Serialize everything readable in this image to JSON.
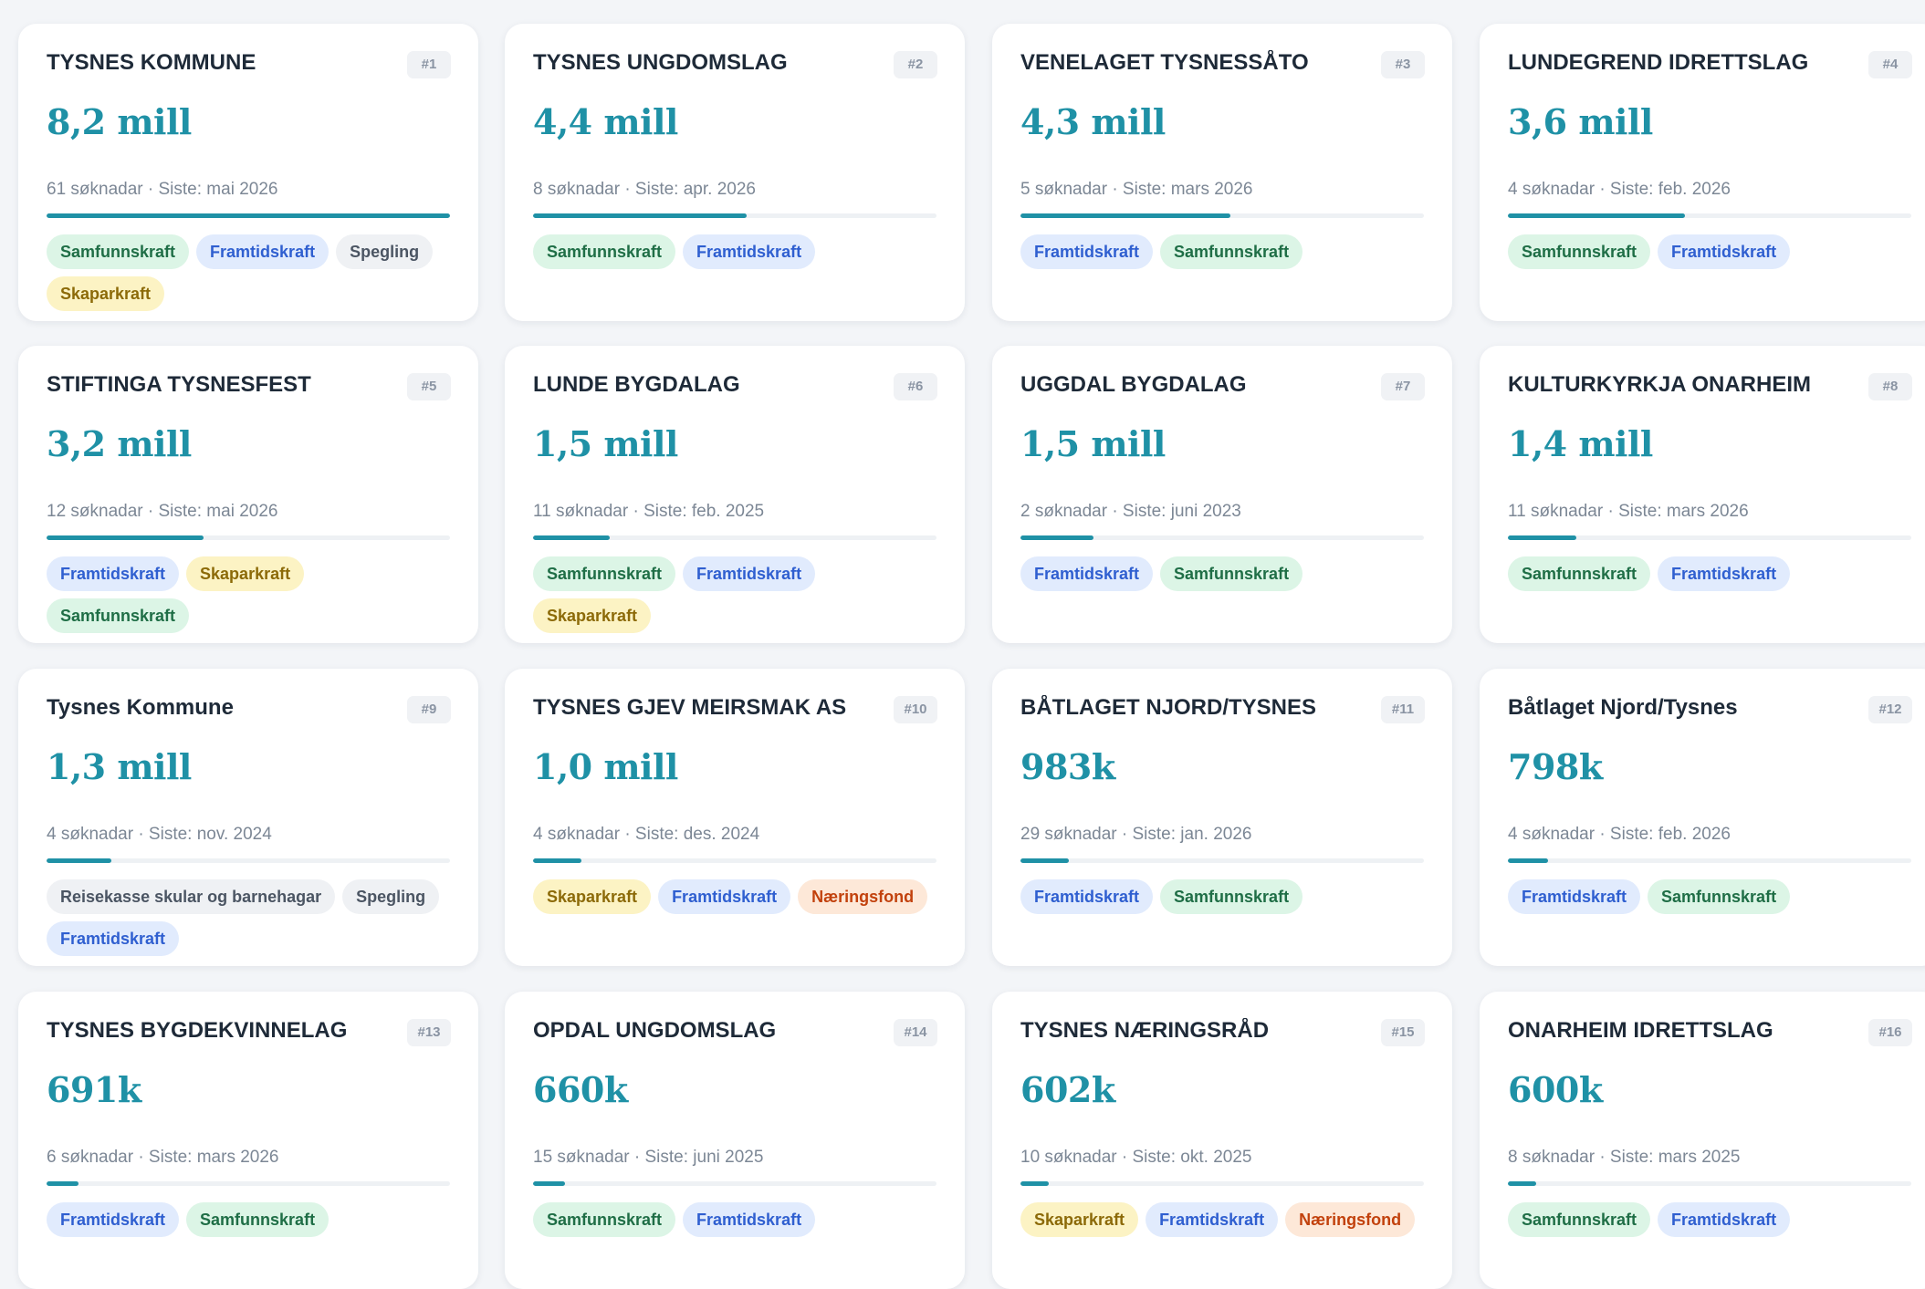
{
  "tag_styles": {
    "Samfunnskraft": {
      "bg": "#dcf5e6",
      "fg": "#1f6e46"
    },
    "Framtidskraft": {
      "bg": "#e1ebfd",
      "fg": "#2f5fd0"
    },
    "Skaparkraft": {
      "bg": "#fcf3c4",
      "fg": "#8c6a08"
    },
    "Spegling": {
      "bg": "#eff1f4",
      "fg": "#4b5563"
    },
    "Reisekasse skular og barnehagar": {
      "bg": "#eff1f4",
      "fg": "#4b5563"
    },
    "Næringsfond": {
      "bg": "#fde8d8",
      "fg": "#c2410c"
    }
  },
  "cards": [
    {
      "name": "TYSNES KOMMUNE",
      "rank": "#1",
      "amount": "8,2 mill",
      "meta": "61 søknadar · Siste: mai 2026",
      "progress": 1.0,
      "tags": [
        "Samfunnskraft",
        "Framtidskraft",
        "Spegling",
        "Skaparkraft"
      ]
    },
    {
      "name": "TYSNES UNGDOMSLAG",
      "rank": "#2",
      "amount": "4,4 mill",
      "meta": "8 søknadar · Siste: apr. 2026",
      "progress": 0.53,
      "tags": [
        "Samfunnskraft",
        "Framtidskraft"
      ]
    },
    {
      "name": "VENELAGET TYSNESSÅTO",
      "rank": "#3",
      "amount": "4,3 mill",
      "meta": "5 søknadar · Siste: mars 2026",
      "progress": 0.52,
      "tags": [
        "Framtidskraft",
        "Samfunnskraft"
      ]
    },
    {
      "name": "LUNDEGREND IDRETTSLAG",
      "rank": "#4",
      "amount": "3,6 mill",
      "meta": "4 søknadar · Siste: feb. 2026",
      "progress": 0.44,
      "tags": [
        "Samfunnskraft",
        "Framtidskraft"
      ]
    },
    {
      "name": "STIFTINGA TYSNESFEST",
      "rank": "#5",
      "amount": "3,2 mill",
      "meta": "12 søknadar · Siste: mai 2026",
      "progress": 0.39,
      "tags": [
        "Framtidskraft",
        "Skaparkraft",
        "Samfunnskraft"
      ]
    },
    {
      "name": "LUNDE BYGDALAG",
      "rank": "#6",
      "amount": "1,5 mill",
      "meta": "11 søknadar · Siste: feb. 2025",
      "progress": 0.19,
      "tags": [
        "Samfunnskraft",
        "Framtidskraft",
        "Skaparkraft"
      ]
    },
    {
      "name": "UGGDAL BYGDALAG",
      "rank": "#7",
      "amount": "1,5 mill",
      "meta": "2 søknadar · Siste: juni 2023",
      "progress": 0.18,
      "tags": [
        "Framtidskraft",
        "Samfunnskraft"
      ]
    },
    {
      "name": "KULTURKYRKJA ONARHEIM",
      "rank": "#8",
      "amount": "1,4 mill",
      "meta": "11 søknadar · Siste: mars 2026",
      "progress": 0.17,
      "tags": [
        "Samfunnskraft",
        "Framtidskraft"
      ]
    },
    {
      "name": "Tysnes Kommune",
      "rank": "#9",
      "amount": "1,3 mill",
      "meta": "4 søknadar · Siste: nov. 2024",
      "progress": 0.16,
      "tags": [
        "Reisekasse skular og barnehagar",
        "Spegling",
        "Framtidskraft"
      ]
    },
    {
      "name": "TYSNES GJEV MEIRSMAK AS",
      "rank": "#10",
      "amount": "1,0 mill",
      "meta": "4 søknadar · Siste: des. 2024",
      "progress": 0.12,
      "tags": [
        "Skaparkraft",
        "Framtidskraft",
        "Næringsfond"
      ]
    },
    {
      "name": "BÅTLAGET NJORD/TYSNES",
      "rank": "#11",
      "amount": "983k",
      "meta": "29 søknadar · Siste: jan. 2026",
      "progress": 0.12,
      "tags": [
        "Framtidskraft",
        "Samfunnskraft"
      ]
    },
    {
      "name": "Båtlaget Njord/Tysnes",
      "rank": "#12",
      "amount": "798k",
      "meta": "4 søknadar · Siste: feb. 2026",
      "progress": 0.1,
      "tags": [
        "Framtidskraft",
        "Samfunnskraft"
      ]
    },
    {
      "name": "TYSNES BYGDEKVINNELAG",
      "rank": "#13",
      "amount": "691k",
      "meta": "6 søknadar · Siste: mars 2026",
      "progress": 0.08,
      "tags": [
        "Framtidskraft",
        "Samfunnskraft"
      ]
    },
    {
      "name": "OPDAL UNGDOMSLAG",
      "rank": "#14",
      "amount": "660k",
      "meta": "15 søknadar · Siste: juni 2025",
      "progress": 0.08,
      "tags": [
        "Samfunnskraft",
        "Framtidskraft"
      ]
    },
    {
      "name": "TYSNES NÆRINGSRÅD",
      "rank": "#15",
      "amount": "602k",
      "meta": "10 søknadar · Siste: okt. 2025",
      "progress": 0.07,
      "tags": [
        "Skaparkraft",
        "Framtidskraft",
        "Næringsfond"
      ]
    },
    {
      "name": "ONARHEIM IDRETTSLAG",
      "rank": "#16",
      "amount": "600k",
      "meta": "8 søknadar · Siste: mars 2025",
      "progress": 0.07,
      "tags": [
        "Samfunnskraft",
        "Framtidskraft"
      ]
    }
  ]
}
